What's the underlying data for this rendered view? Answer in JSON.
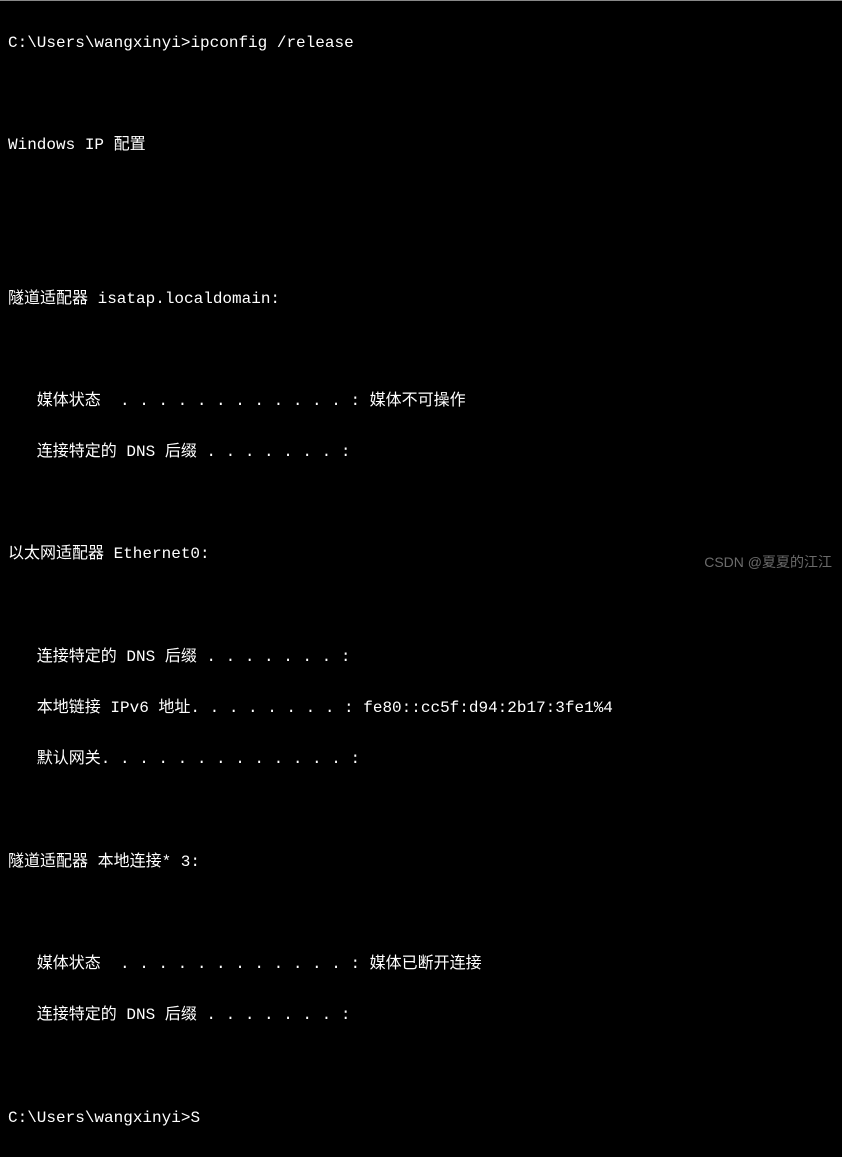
{
  "terminal": {
    "prompt_path": "C:\\Users\\wangxinyi>",
    "command": "ipconfig /release",
    "header": "Windows IP 配置",
    "sections": [
      {
        "title": "隧道适配器 isatap.localdomain:",
        "media_state_label": "   媒体状态  . . . . . . . . . . . . : ",
        "media_state_value": "媒体不可操作",
        "dns_suffix_label": "   连接特定的 DNS 后缀 . . . . . . . :"
      },
      {
        "title": "以太网适配器 Ethernet0:",
        "dns_suffix_label": "   连接特定的 DNS 后缀 . . . . . . . :",
        "ipv6_label": "   本地链接 IPv6 地址. . . . . . . . : ",
        "ipv6_value": "fe80::cc5f:d94:2b17:3fe1%4",
        "gateway_label": "   默认网关. . . . . . . . . . . . . :"
      },
      {
        "title": "隧道适配器 本地连接* 3:",
        "media_state_label": "   媒体状态  . . . . . . . . . . . . : ",
        "media_state_value": "媒体已断开连接",
        "dns_suffix_label": "   连接特定的 DNS 后缀 . . . . . . . :"
      }
    ],
    "prompt2_input": "S"
  },
  "watermark": "CSDN @夏夏的江江"
}
